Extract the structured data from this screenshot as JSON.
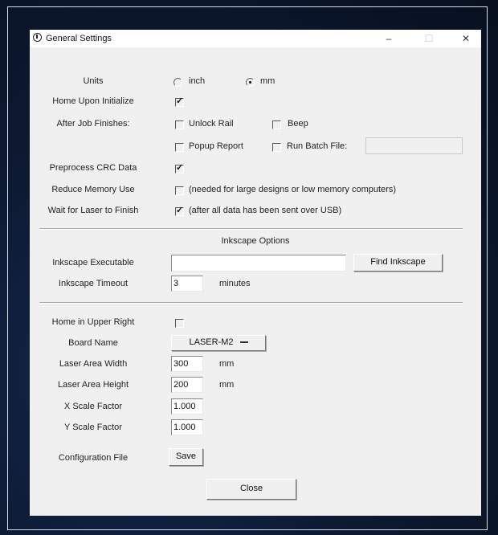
{
  "window": {
    "title": "General Settings",
    "minimize": "–",
    "maximize": "☐",
    "close": "✕"
  },
  "units": {
    "label": "Units",
    "options": [
      {
        "label": "inch",
        "selected": false
      },
      {
        "label": "mm",
        "selected": true
      }
    ]
  },
  "home_upon_initialize": {
    "label": "Home Upon Initialize",
    "checked": true
  },
  "after_job": {
    "label": "After Job Finishes:",
    "unlock_rail": {
      "label": "Unlock Rail",
      "checked": false
    },
    "beep": {
      "label": "Beep",
      "checked": false
    },
    "popup_report": {
      "label": "Popup Report",
      "checked": false
    },
    "run_batch": {
      "label": "Run Batch File:",
      "checked": false,
      "value": ""
    }
  },
  "preprocess_crc": {
    "label": "Preprocess CRC Data",
    "checked": true
  },
  "reduce_memory": {
    "label": "Reduce Memory Use",
    "checked": false,
    "note": "(needed for large designs or low memory computers)"
  },
  "wait_laser": {
    "label": "Wait for Laser to Finish",
    "checked": true,
    "note": "(after all data has been sent over USB)"
  },
  "inkscape": {
    "section_title": "Inkscape Options",
    "executable_label": "Inkscape Executable",
    "executable_value": "",
    "find_button": "Find Inkscape",
    "timeout_label": "Inkscape Timeout",
    "timeout_value": "3",
    "timeout_unit": "minutes"
  },
  "machine": {
    "home_upper_right": {
      "label": "Home in Upper Right",
      "checked": false
    },
    "board_name": {
      "label": "Board Name",
      "value": "LASER-M2"
    },
    "area_width": {
      "label": "Laser Area Width",
      "value": "300",
      "unit": "mm"
    },
    "area_height": {
      "label": "Laser Area Height",
      "value": "200",
      "unit": "mm"
    },
    "x_scale": {
      "label": "X Scale Factor",
      "value": "1.000"
    },
    "y_scale": {
      "label": "Y Scale Factor",
      "value": "1.000"
    },
    "config_file": {
      "label": "Configuration File",
      "save_button": "Save"
    }
  },
  "close_button": "Close"
}
